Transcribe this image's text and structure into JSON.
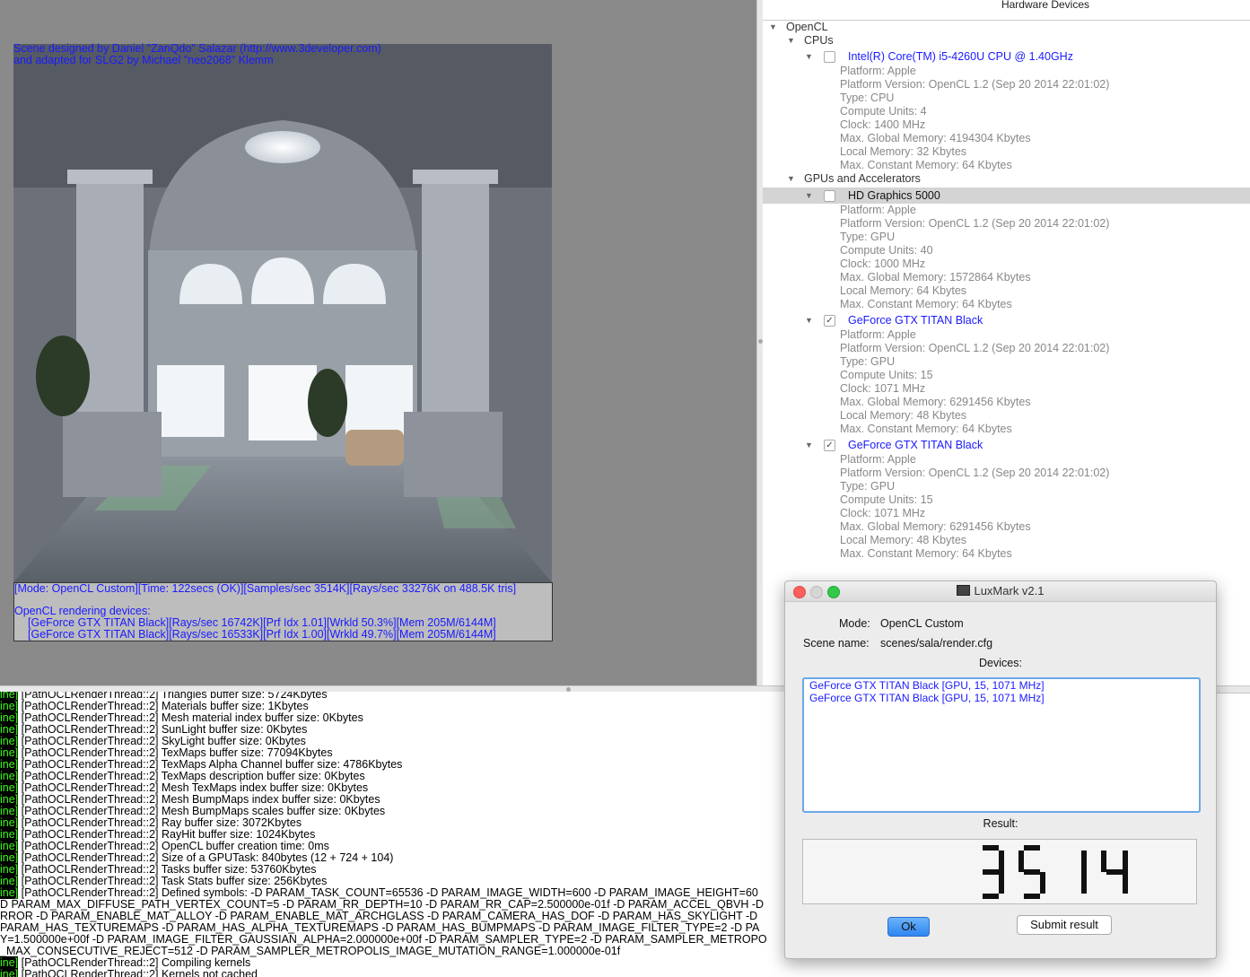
{
  "render": {
    "credits": [
      "Scene designed by Daniel \"ZanQdo\" Salazar (http://www.3developer.com)",
      "and adapted for SLG2 by Michael \"neo2068\" Klemm"
    ],
    "status_line": "[Mode: OpenCL Custom][Time: 122secs (OK)][Samples/sec  3514K][Rays/sec  33276K on 488.5K tris]",
    "devices_header": "OpenCL rendering devices:",
    "device_lines": [
      "[GeForce GTX TITAN Black][Rays/sec  16742K][Prf Idx 1.01][Wrkld 50.3%][Mem 205M/6144M]",
      "[GeForce GTX TITAN Black][Rays/sec  16533K][Prf Idx 1.00][Wrkld 49.7%][Mem 205M/6144M]"
    ]
  },
  "hardware": {
    "title": "Hardware Devices",
    "rows": [
      {
        "kind": "group",
        "text": "OpenCL"
      },
      {
        "kind": "group",
        "text": "CPUs"
      },
      {
        "kind": "device",
        "text": "Intel(R) Core(TM) i5-4260U CPU @ 1.40GHz",
        "checked": false
      },
      {
        "kind": "prop",
        "text": "Platform: Apple"
      },
      {
        "kind": "prop",
        "text": "Platform Version: OpenCL 1.2 (Sep 20 2014 22:01:02)"
      },
      {
        "kind": "prop",
        "text": "Type: CPU"
      },
      {
        "kind": "prop",
        "text": "Compute Units: 4"
      },
      {
        "kind": "prop",
        "text": "Clock: 1400 MHz"
      },
      {
        "kind": "prop",
        "text": "Max. Global Memory: 4194304 Kbytes"
      },
      {
        "kind": "prop",
        "text": "Local Memory: 32 Kbytes"
      },
      {
        "kind": "prop",
        "text": "Max. Constant Memory: 64 Kbytes"
      },
      {
        "kind": "group",
        "text": "GPUs and Accelerators"
      },
      {
        "kind": "device",
        "text": "HD Graphics 5000",
        "checked": false,
        "selected": true
      },
      {
        "kind": "prop",
        "text": "Platform: Apple"
      },
      {
        "kind": "prop",
        "text": "Platform Version: OpenCL 1.2 (Sep 20 2014 22:01:02)"
      },
      {
        "kind": "prop",
        "text": "Type: GPU"
      },
      {
        "kind": "prop",
        "text": "Compute Units: 40"
      },
      {
        "kind": "prop",
        "text": "Clock: 1000 MHz"
      },
      {
        "kind": "prop",
        "text": "Max. Global Memory: 1572864 Kbytes"
      },
      {
        "kind": "prop",
        "text": "Local Memory: 64 Kbytes"
      },
      {
        "kind": "prop",
        "text": "Max. Constant Memory: 64 Kbytes"
      },
      {
        "kind": "device",
        "text": "GeForce GTX TITAN Black",
        "checked": true
      },
      {
        "kind": "prop",
        "text": "Platform: Apple"
      },
      {
        "kind": "prop",
        "text": "Platform Version: OpenCL 1.2 (Sep 20 2014 22:01:02)"
      },
      {
        "kind": "prop",
        "text": "Type: GPU"
      },
      {
        "kind": "prop",
        "text": "Compute Units: 15"
      },
      {
        "kind": "prop",
        "text": "Clock: 1071 MHz"
      },
      {
        "kind": "prop",
        "text": "Max. Global Memory: 6291456 Kbytes"
      },
      {
        "kind": "prop",
        "text": "Local Memory: 48 Kbytes"
      },
      {
        "kind": "prop",
        "text": "Max. Constant Memory: 64 Kbytes"
      },
      {
        "kind": "device",
        "text": "GeForce GTX TITAN Black",
        "checked": true
      },
      {
        "kind": "prop",
        "text": "Platform: Apple"
      },
      {
        "kind": "prop",
        "text": "Platform Version: OpenCL 1.2 (Sep 20 2014 22:01:02)"
      },
      {
        "kind": "prop",
        "text": "Type: GPU"
      },
      {
        "kind": "prop",
        "text": "Compute Units: 15"
      },
      {
        "kind": "prop",
        "text": "Clock: 1071 MHz"
      },
      {
        "kind": "prop",
        "text": "Max. Global Memory: 6291456 Kbytes"
      },
      {
        "kind": "prop",
        "text": "Local Memory: 48 Kbytes"
      },
      {
        "kind": "prop",
        "text": "Max. Constant Memory: 64 Kbytes"
      }
    ]
  },
  "log": {
    "lines": [
      {
        "tag": "ine]",
        "text": " [PathOCLRenderThread::2] Triangles buffer size: 5724Kbytes"
      },
      {
        "tag": "ine]",
        "text": " [PathOCLRenderThread::2] Materials buffer size: 1Kbytes"
      },
      {
        "tag": "ine]",
        "text": " [PathOCLRenderThread::2] Mesh material index buffer size: 0Kbytes"
      },
      {
        "tag": "ine]",
        "text": " [PathOCLRenderThread::2] SunLight buffer size: 0Kbytes"
      },
      {
        "tag": "ine]",
        "text": " [PathOCLRenderThread::2] SkyLight buffer size: 0Kbytes"
      },
      {
        "tag": "ine]",
        "text": " [PathOCLRenderThread::2] TexMaps buffer size: 77094Kbytes"
      },
      {
        "tag": "ine]",
        "text": " [PathOCLRenderThread::2] TexMaps Alpha Channel buffer size: 4786Kbytes"
      },
      {
        "tag": "ine]",
        "text": " [PathOCLRenderThread::2] TexMaps description buffer size: 0Kbytes"
      },
      {
        "tag": "ine]",
        "text": " [PathOCLRenderThread::2] Mesh TexMaps index buffer size: 0Kbytes"
      },
      {
        "tag": "ine]",
        "text": " [PathOCLRenderThread::2] Mesh BumpMaps index buffer size: 0Kbytes"
      },
      {
        "tag": "ine]",
        "text": " [PathOCLRenderThread::2] Mesh BumpMaps scales buffer size: 0Kbytes"
      },
      {
        "tag": "ine]",
        "text": " [PathOCLRenderThread::2] Ray buffer size: 3072Kbytes"
      },
      {
        "tag": "ine]",
        "text": " [PathOCLRenderThread::2] RayHit buffer size: 1024Kbytes"
      },
      {
        "tag": "ine]",
        "text": " [PathOCLRenderThread::2] OpenCL buffer creation time: 0ms"
      },
      {
        "tag": "ine]",
        "text": " [PathOCLRenderThread::2] Size of a GPUTask: 840bytes (12 + 724 + 104)"
      },
      {
        "tag": "ine]",
        "text": " [PathOCLRenderThread::2] Tasks buffer size: 53760Kbytes"
      },
      {
        "tag": "ine]",
        "text": " [PathOCLRenderThread::2] Task Stats buffer size: 256Kbytes"
      },
      {
        "tag": "ine]",
        "text": " [PathOCLRenderThread::2] Defined symbols: -D PARAM_TASK_COUNT=65536 -D PARAM_IMAGE_WIDTH=600 -D PARAM_IMAGE_HEIGHT=60"
      },
      {
        "tag": "",
        "text": "D PARAM_MAX_DIFFUSE_PATH_VERTEX_COUNT=5 -D PARAM_RR_DEPTH=10 -D PARAM_RR_CAP=2.500000e-01f -D PARAM_ACCEL_QBVH -D"
      },
      {
        "tag": "",
        "text": "RROR -D PARAM_ENABLE_MAT_ALLOY -D PARAM_ENABLE_MAT_ARCHGLASS -D PARAM_CAMERA_HAS_DOF -D PARAM_HAS_SKYLIGHT -D"
      },
      {
        "tag": "",
        "text": "PARAM_HAS_TEXTUREMAPS -D PARAM_HAS_ALPHA_TEXTUREMAPS -D PARAM_HAS_BUMPMAPS -D PARAM_IMAGE_FILTER_TYPE=2 -D PA"
      },
      {
        "tag": "",
        "text": "Y=1.500000e+00f -D PARAM_IMAGE_FILTER_GAUSSIAN_ALPHA=2.000000e+00f -D PARAM_SAMPLER_TYPE=2 -D PARAM_SAMPLER_METROPO"
      },
      {
        "tag": "",
        "text": "_MAX_CONSECUTIVE_REJECT=512 -D PARAM_SAMPLER_METROPOLIS_IMAGE_MUTATION_RANGE=1.000000e-01f"
      },
      {
        "tag": "ine]",
        "text": " [PathOCLRenderThread::2] Compiling kernels"
      },
      {
        "tag": "ine]",
        "text": " [PathOCLRenderThread::2] Kernels not cached"
      }
    ]
  },
  "dialog": {
    "title": "LuxMark v2.1",
    "mode_label": "Mode:",
    "mode_value": "OpenCL Custom",
    "scene_label": "Scene name:",
    "scene_value": "scenes/sala/render.cfg",
    "devices_label": "Devices:",
    "devices": [
      "GeForce GTX TITAN Black [GPU, 15, 1071 MHz]",
      "GeForce GTX TITAN Black [GPU, 15, 1071 MHz]"
    ],
    "result_label": "Result:",
    "result_value": "3514",
    "ok_label": "Ok",
    "submit_label": "Submit result"
  }
}
